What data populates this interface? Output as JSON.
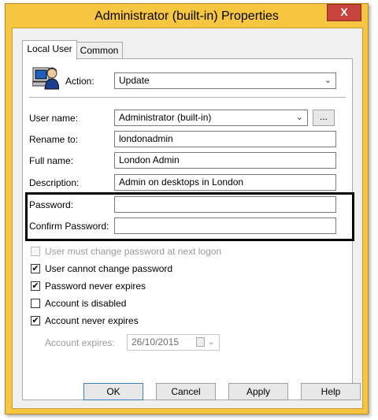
{
  "window": {
    "title": "Administrator (built-in) Properties",
    "close_glyph": "X"
  },
  "tabs": [
    {
      "label": "Local User"
    },
    {
      "label": "Common"
    }
  ],
  "action": {
    "label": "Action:",
    "value": "Update"
  },
  "fields": {
    "user_name": {
      "label": "User name:",
      "value": "Administrator (built-in)",
      "browse": "..."
    },
    "rename_to": {
      "label": "Rename to:",
      "value": "londonadmin"
    },
    "full_name": {
      "label": "Full name:",
      "value": "London Admin"
    },
    "description": {
      "label": "Description:",
      "value": "Admin on desktops in London"
    },
    "password": {
      "label": "Password:",
      "value": ""
    },
    "confirm_password": {
      "label": "Confirm Password:",
      "value": ""
    }
  },
  "checkboxes": [
    {
      "label": "User must change password at next logon",
      "checked": false,
      "disabled": true
    },
    {
      "label": "User cannot change password",
      "checked": true,
      "disabled": false
    },
    {
      "label": "Password never expires",
      "checked": true,
      "disabled": false
    },
    {
      "label": "Account is disabled",
      "checked": false,
      "disabled": false
    },
    {
      "label": "Account never expires",
      "checked": true,
      "disabled": false
    }
  ],
  "account_expires": {
    "label": "Account expires:",
    "value": "26/10/2015"
  },
  "buttons": {
    "ok": "OK",
    "cancel": "Cancel",
    "apply": "Apply",
    "help": "Help"
  },
  "glyphs": {
    "check": "✔",
    "chevron": "⌄"
  },
  "colors": {
    "title_bar": "#f6c640",
    "close_button": "#c7433b",
    "highlight_border": "#000000"
  }
}
